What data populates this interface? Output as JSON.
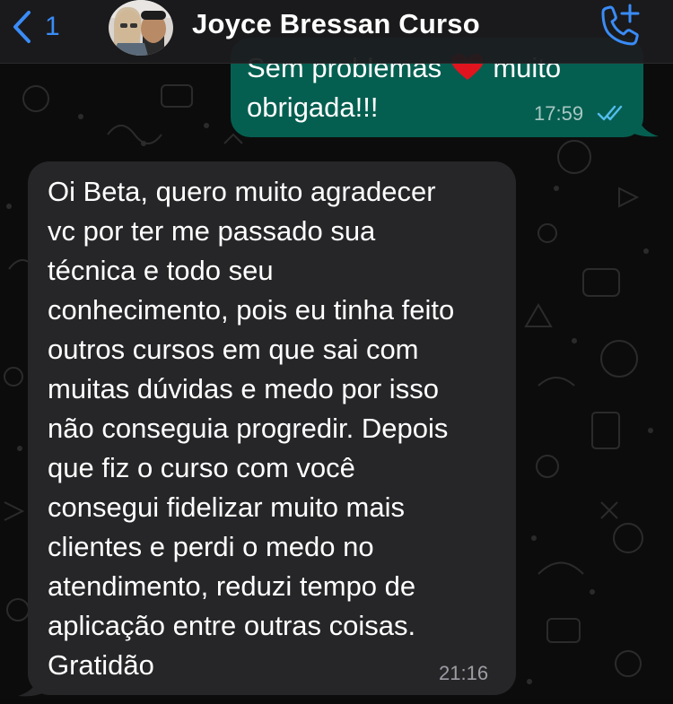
{
  "header": {
    "back_count": "1",
    "contact_name": "Joyce Bressan Curso"
  },
  "messages": [
    {
      "direction": "outgoing",
      "text_line1": "Sem problemas",
      "text_line1_after": "muito",
      "text_line2": "obrigada!!!",
      "time": "17:59",
      "status": "read"
    },
    {
      "direction": "incoming",
      "lines": [
        "Oi Beta, quero muito agradecer",
        "vc por ter me passado sua",
        "técnica e todo seu",
        "conhecimento, pois eu tinha feito",
        "outros cursos em que sai com",
        "muitas dúvidas e medo por isso",
        "não conseguia progredir. Depois",
        "que fiz o curso com você",
        "consegui fidelizar muito mais",
        "clientes e perdi o medo no",
        "atendimento, reduzi tempo de",
        "aplicação entre outras coisas.",
        "Gratidão"
      ],
      "time": "21:16"
    }
  ],
  "colors": {
    "accent": "#3a8cf7",
    "outgoing_bubble": "#055f51",
    "incoming_bubble": "#262628",
    "background": "#0c0c0c"
  },
  "icons": {
    "back": "chevron-left-icon",
    "call": "phone-plus-icon",
    "heart": "heart-icon",
    "read": "double-check-icon"
  }
}
